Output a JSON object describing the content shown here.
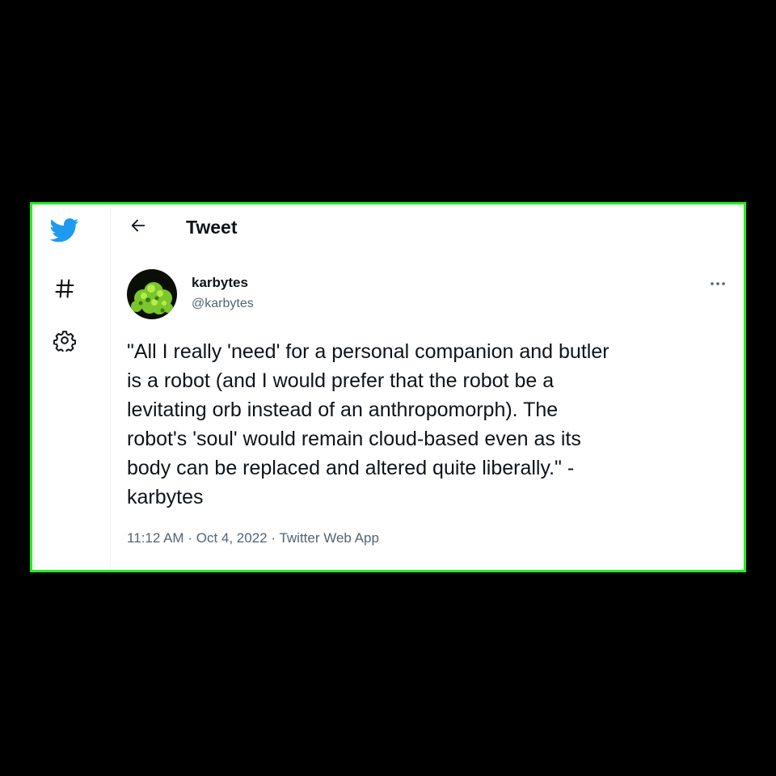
{
  "sidebar": {
    "items": [
      {
        "icon": "twitter-bird-icon"
      },
      {
        "icon": "hashtag-icon"
      },
      {
        "icon": "gear-icon"
      }
    ]
  },
  "header": {
    "title": "Tweet"
  },
  "tweet": {
    "display_name": "karbytes",
    "handle": "@karbytes",
    "text": "\"All I really 'need' for a personal companion and butler\nis a robot (and I would prefer that the robot be a\nlevitating orb instead of an anthropomorph). The\nrobot's 'soul' would remain cloud-based even as its\nbody can be replaced and altered quite liberally.\" -\nkarbytes",
    "time": "11:12 AM",
    "date": "Oct 4, 2022",
    "source": "Twitter Web App",
    "separator": "·"
  },
  "colors": {
    "brand": "#1d9bf0",
    "frame_border": "#1ef21b",
    "text_primary": "#0f1419",
    "text_secondary": "#536471"
  }
}
